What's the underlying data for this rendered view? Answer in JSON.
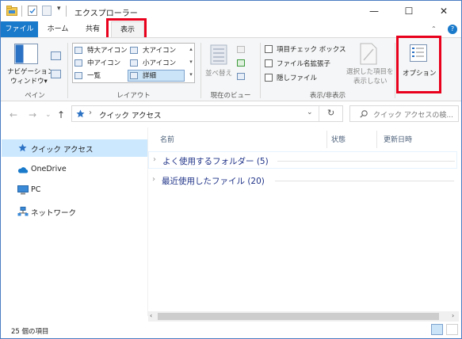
{
  "window": {
    "title": "エクスプローラー",
    "controls": {
      "minimize": "—",
      "maximize": "☐",
      "close": "✕"
    }
  },
  "ribbon_tabs": {
    "file": "ファイル",
    "home": "ホーム",
    "share": "共有",
    "view": "表示",
    "active": "表示",
    "help": "?"
  },
  "panes_group": {
    "nav_pane_line1": "ナビゲーション",
    "nav_pane_line2": "ウィンドウ▾",
    "label": "ペイン"
  },
  "layout_group": {
    "options": [
      "特大アイコン",
      "大アイコン",
      "中アイコン",
      "小アイコン",
      "一覧",
      "詳細"
    ],
    "selected": "詳細",
    "label": "レイアウト"
  },
  "current_view_group": {
    "sort_line1": "並べ替え",
    "label": "現在のビュー"
  },
  "show_hide_group": {
    "checkboxes": [
      "項目チェック ボックス",
      "ファイル名拡張子",
      "隠しファイル"
    ],
    "hide_selected_line1": "選択した項目を",
    "hide_selected_line2": "表示しない",
    "options_label": "オプション",
    "label": "表示/非表示"
  },
  "highlight_color": "#e8001c",
  "accent_color": "#1979ca",
  "address": {
    "separator": "›",
    "location": "クイック アクセス",
    "search_placeholder": "クイック アクセスの検..."
  },
  "nav": {
    "items": [
      "クイック アクセス",
      "OneDrive",
      "PC",
      "ネットワーク"
    ],
    "selected": "クイック アクセス"
  },
  "columns": [
    "名前",
    "状態",
    "更新日時"
  ],
  "groups": [
    {
      "title": "よく使用するフォルダー (5)"
    },
    {
      "title": "最近使用したファイル (20)"
    }
  ],
  "status": {
    "item_count": "25 個の項目"
  }
}
